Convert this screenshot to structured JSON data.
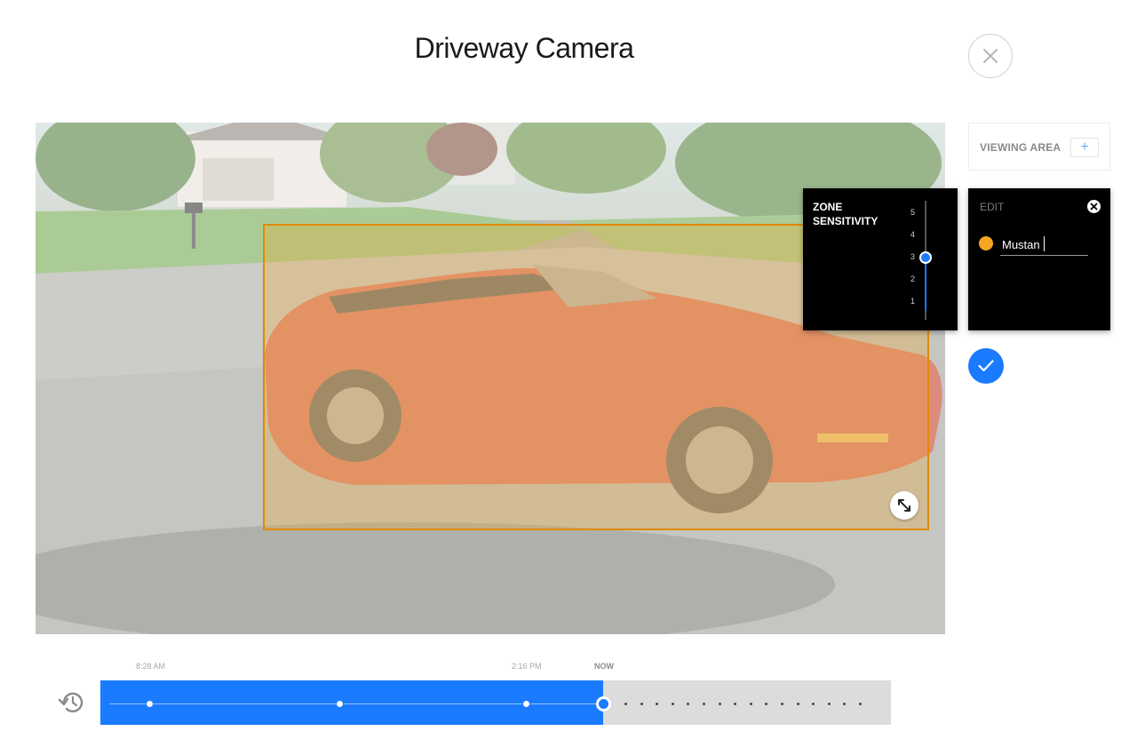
{
  "header": {
    "title": "Driveway Camera"
  },
  "zone": {
    "sensitivity_label": "ZONE SENSITIVITY",
    "sensitivity_ticks": [
      "5",
      "4",
      "3",
      "2",
      "1"
    ],
    "sensitivity_value": 3,
    "sensitivity_max": 5,
    "color": "#f5a623"
  },
  "viewing_area": {
    "label": "VIEWING AREA",
    "add_symbol": "+"
  },
  "edit": {
    "label": "EDIT",
    "name_value": "Mustan"
  },
  "timeline": {
    "labels": [
      {
        "text": "8:28 AM"
      },
      {
        "text": "2:16 PM"
      },
      {
        "text": "NOW"
      }
    ],
    "elapsed_fraction": 0.636,
    "event_positions": [
      0.062,
      0.302,
      0.538
    ],
    "future_tick_count": 16
  },
  "colors": {
    "accent": "#1a7bff",
    "zone": "#f5a623",
    "panel": "#000000"
  }
}
